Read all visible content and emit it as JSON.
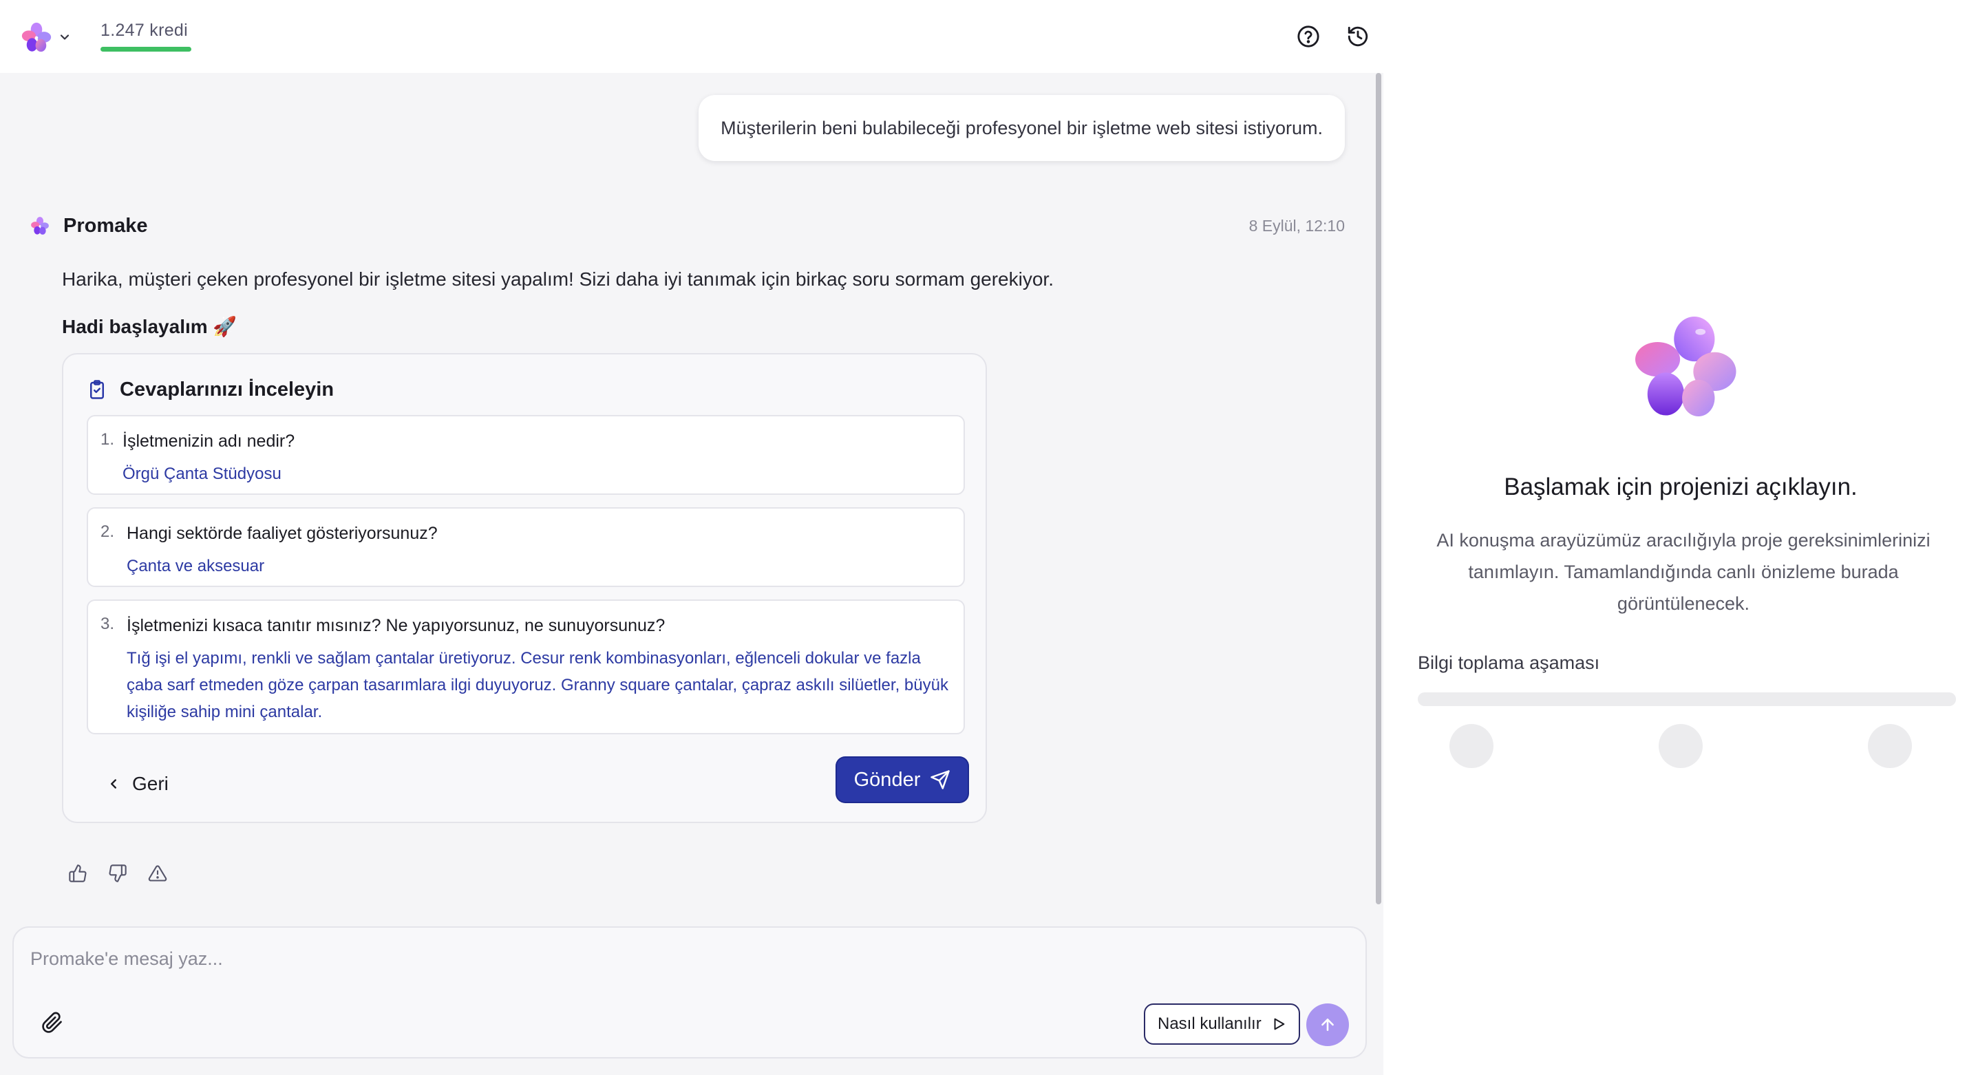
{
  "header": {
    "credits_text": "1.247 kredi",
    "credits_bar_color": "#3ebf62",
    "help_icon": "help-circle-icon",
    "history_icon": "history-icon"
  },
  "chat": {
    "user_message": "Müşterilerin beni bulabileceği profesyonel bir işletme web sitesi istiyorum.",
    "assistant": {
      "name": "Promake",
      "timestamp": "8 Eylül, 12:10",
      "text": "Harika, müşteri çeken profesyonel bir işletme sitesi yapalım! Sizi daha iyi tanımak için birkaç soru sormam gerekiyor.",
      "text2": "Hadi başlayalım 🚀"
    },
    "review": {
      "title": "Cevaplarınızı İnceleyin",
      "items": [
        {
          "num": "1.",
          "question": "İşletmenizin adı nedir?",
          "answer": "Örgü Çanta Stüdyosu"
        },
        {
          "num": "2.",
          "question": "Hangi sektörde faaliyet gösteriyorsunuz?",
          "answer": "Çanta ve aksesuar"
        },
        {
          "num": "3.",
          "question": "İşletmenizi kısaca tanıtır mısınız? Ne yapıyorsunuz, ne sunuyorsunuz?",
          "answer": "Tığ işi el yapımı, renkli ve sağlam çantalar üretiyoruz. Cesur renk kombinasyonları, eğlenceli dokular ve fazla çaba sarf etmeden göze çarpan tasarımlara ilgi duyuyoruz. Granny square çantalar, çapraz askılı silüetler, büyük kişiliğe sahip mini çantalar."
        }
      ],
      "back_label": "Geri",
      "send_label": "Gönder",
      "send_color": "#2a38a8"
    },
    "feedback_icons": [
      "thumbs-up-icon",
      "thumbs-down-icon",
      "warning-icon"
    ]
  },
  "composer": {
    "placeholder": "Promake'e mesaj yaz...",
    "howto_label": "Nasıl kullanılır",
    "send_color": "#a995f0"
  },
  "preview": {
    "title": "Başlamak için projenizi açıklayın.",
    "description": "AI konuşma arayüzümüz aracılığıyla proje gereksinimlerinizi tanımlayın. Tamamlandığında canlı önizleme burada görüntülenecek.",
    "stage_label": "Bilgi toplama aşaması",
    "stage_progress": 0
  }
}
